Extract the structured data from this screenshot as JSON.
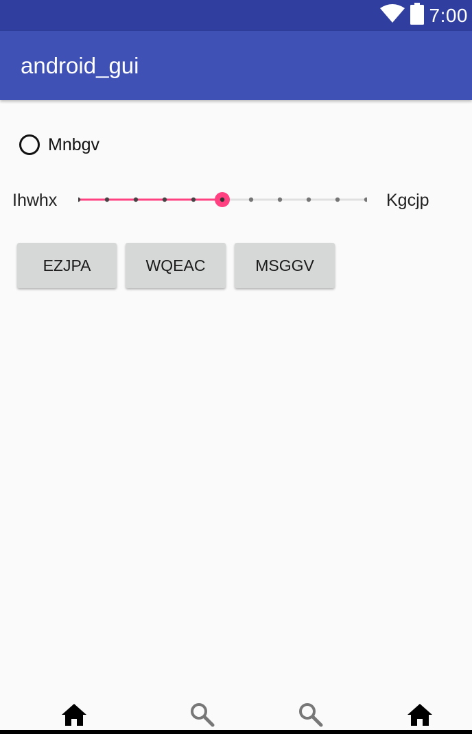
{
  "status_bar": {
    "time": "7:00",
    "icons": [
      "wifi-icon",
      "battery-icon"
    ]
  },
  "app_bar": {
    "title": "android_gui"
  },
  "radio": {
    "label": "Mnbgv",
    "checked": false
  },
  "slider": {
    "min_label": "Ihwhx",
    "max_label": "Kgcjp",
    "steps": 10,
    "value": 5
  },
  "buttons": [
    {
      "label": "EZJPA"
    },
    {
      "label": "WQEAC"
    },
    {
      "label": "MSGGV"
    }
  ],
  "bottom_nav": {
    "items": [
      {
        "icon": "home-icon"
      },
      {
        "icon": "search-icon"
      },
      {
        "icon": "search-icon"
      },
      {
        "icon": "home-icon"
      }
    ]
  },
  "colors": {
    "status_bar": "#303f9f",
    "app_bar": "#3f51b5",
    "accent": "#ff4081",
    "background": "#fafafa",
    "button": "#d6d7d7"
  }
}
